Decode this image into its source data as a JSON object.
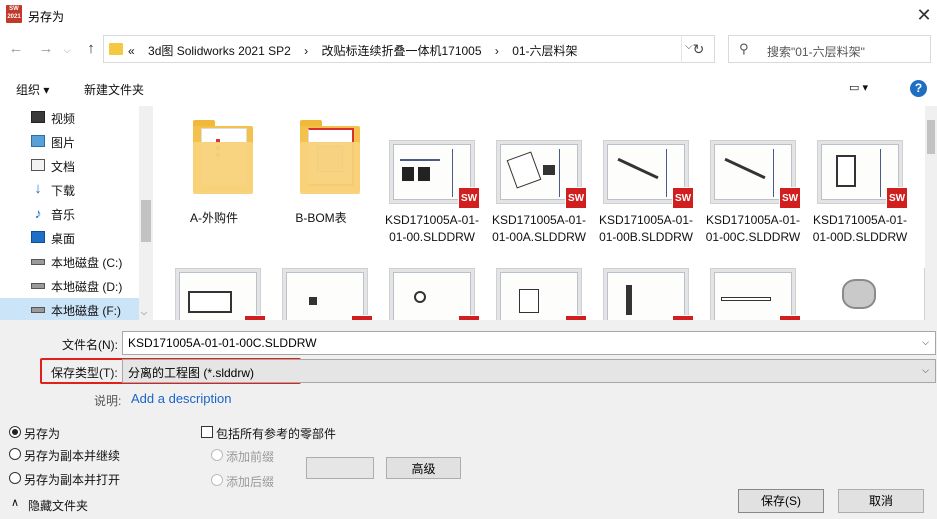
{
  "window": {
    "title": "另存为",
    "app_icon_text": "SW 2021",
    "close_glyph": "✕"
  },
  "nav": {
    "back": "←",
    "forward": "→",
    "up": "↑"
  },
  "address": {
    "prefix": "«",
    "crumbs": [
      "3d图 Solidworks 2021 SP2",
      "›",
      "改贴标连续折叠一体机171005",
      "›",
      "01-六层料架"
    ],
    "refresh": "↻"
  },
  "search": {
    "placeholder": "搜索\"01-六层料架\""
  },
  "toolbar": {
    "organize": "组织 ▾",
    "new_folder": "新建文件夹",
    "view_glyph": "▭ ▾",
    "help": "?"
  },
  "sidebar": {
    "items": [
      {
        "label": "视频",
        "icon": "video-icon"
      },
      {
        "label": "图片",
        "icon": "pictures-icon"
      },
      {
        "label": "文档",
        "icon": "documents-icon"
      },
      {
        "label": "下载",
        "icon": "download-icon"
      },
      {
        "label": "音乐",
        "icon": "music-icon"
      },
      {
        "label": "桌面",
        "icon": "desktop-icon"
      },
      {
        "label": "本地磁盘 (C:)",
        "icon": "drive-icon"
      },
      {
        "label": "本地磁盘 (D:)",
        "icon": "drive-icon"
      },
      {
        "label": "本地磁盘 (F:)",
        "icon": "drive-icon"
      }
    ]
  },
  "files": [
    {
      "name": "A-外购件",
      "type": "folder"
    },
    {
      "name": "B-BOM表",
      "type": "folder"
    },
    {
      "name": "KSD171005A-01-01-00.SLDDRW",
      "type": "drawing"
    },
    {
      "name": "KSD171005A-01-01-00A.SLDDRW",
      "type": "drawing"
    },
    {
      "name": "KSD171005A-01-01-00B.SLDDRW",
      "type": "drawing"
    },
    {
      "name": "KSD171005A-01-01-00C.SLDDRW",
      "type": "drawing"
    },
    {
      "name": "KSD171005A-01-01-00D.SLDDRW",
      "type": "drawing"
    },
    {
      "name": "",
      "type": "drawing"
    },
    {
      "name": "",
      "type": "drawing"
    },
    {
      "name": "",
      "type": "drawing"
    },
    {
      "name": "",
      "type": "drawing"
    },
    {
      "name": "",
      "type": "drawing"
    },
    {
      "name": "",
      "type": "drawing"
    },
    {
      "name": "",
      "type": "drawing"
    }
  ],
  "sw_badge": "SW",
  "form": {
    "filename_label": "文件名(N):",
    "filename_value": "KSD171005A-01-01-00C.SLDDRW",
    "filetype_label": "保存类型(T):",
    "filetype_value": "分离的工程图 (*.slddrw)",
    "description_label": "说明:",
    "description_link": "Add a description",
    "dd_glyph": "⌵"
  },
  "options": {
    "save_as": "另存为",
    "save_copy_continue": "另存为副本并继续",
    "save_copy_open": "另存为副本并打开",
    "include_refs": "包括所有参考的零部件",
    "add_prefix": "添加前缀",
    "add_suffix": "添加后缀",
    "advanced": "高级"
  },
  "footer": {
    "hide_folders": "隐藏文件夹",
    "hide_glyph": "∧",
    "save": "保存(S)",
    "cancel": "取消"
  }
}
